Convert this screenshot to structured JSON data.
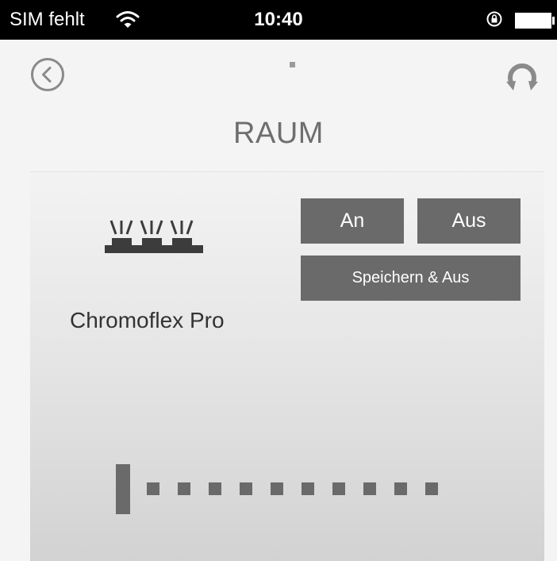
{
  "status_bar": {
    "carrier": "SIM fehlt",
    "time": "10:40",
    "icons": [
      "wifi-icon",
      "rotation-lock-icon",
      "battery-icon"
    ]
  },
  "nav": {
    "back_icon": "chevron-left-circle-icon",
    "refresh_icon": "refresh-icon"
  },
  "page": {
    "title": "RAUM"
  },
  "device": {
    "name": "Chromoflex Pro",
    "icon": "led-strip-icon",
    "buttons": {
      "on_label": "An",
      "off_label": "Aus",
      "save_off_label": "Speichern & Aus"
    },
    "slider": {
      "steps": 10,
      "value": 0
    }
  },
  "colors": {
    "status_bar_bg": "#000000",
    "page_bg": "#f4f4f4",
    "button_bg": "#6a6a6a",
    "button_text": "#ffffff",
    "title_text": "#6e6e6e",
    "icon_gray": "#8a8a8a"
  }
}
